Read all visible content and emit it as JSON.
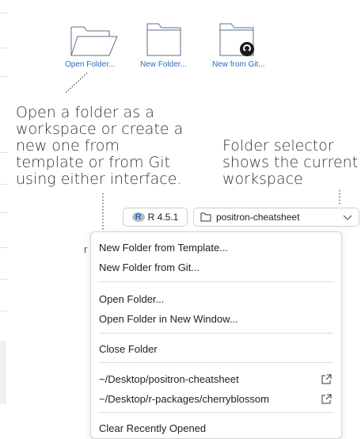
{
  "welcome_actions": [
    {
      "label": "Open Folder..."
    },
    {
      "label": "New Folder..."
    },
    {
      "label": "New from Git..."
    }
  ],
  "annotations": {
    "left": "Open a folder as a\nworkspace or create a\nnew one from\ntemplate or from Git\nusing either interface.",
    "right": "Folder selector\nshows the current\nworkspace"
  },
  "toolbar": {
    "r_version": "R 4.5.1",
    "folder": "positron-cheatsheet"
  },
  "menu": {
    "items": [
      "New Folder from Template...",
      "New Folder from Git...",
      "Open Folder...",
      "Open Folder in New Window...",
      "Close Folder",
      "~/Desktop/positron-cheatsheet",
      "~/Desktop/r-packages/cherryblossom",
      "Clear Recently Opened"
    ]
  },
  "colors": {
    "accent": "#2b6cc4",
    "r_logo": "#2d6cc0",
    "icon_stroke": "#5b6f8a"
  },
  "icons": [
    "folder-open-icon",
    "folder-icon",
    "github-folder-icon",
    "r-logo-icon",
    "folder-outline-icon",
    "chevron-down-icon",
    "open-external-icon"
  ]
}
